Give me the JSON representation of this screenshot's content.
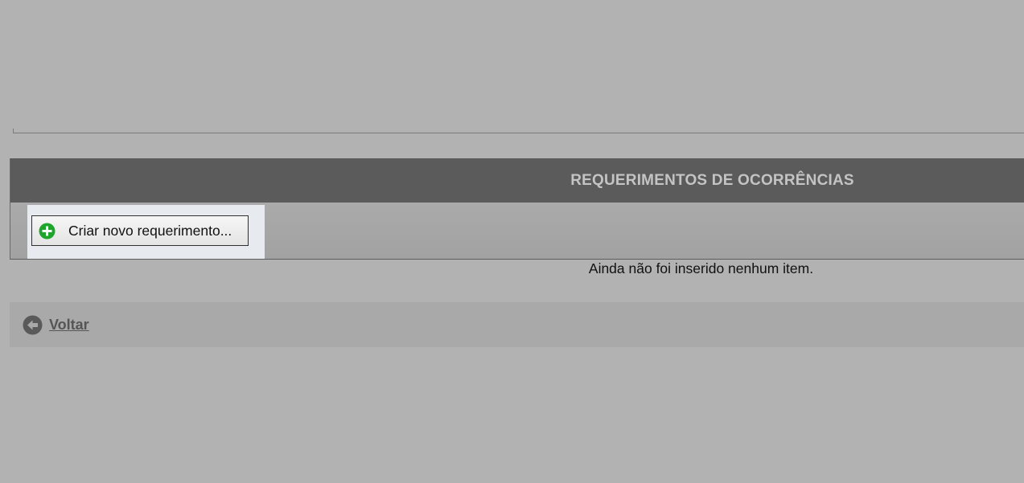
{
  "section": {
    "title": "REQUERIMENTOS DE OCORRÊNCIAS"
  },
  "toolbar": {
    "create_label": "Criar novo requerimento...",
    "create_icon": "plus-circle-icon"
  },
  "list": {
    "empty_message": "Ainda não foi inserido nenhum item."
  },
  "footer": {
    "back_label": "Voltar",
    "back_icon": "arrow-left-circle-icon"
  },
  "colors": {
    "overlay_background": "#b2b2b2",
    "header_background": "#5b5b5b",
    "header_text": "#c4c4c4",
    "highlight": "#e7ebef",
    "add_icon": "#1ea52c",
    "back_icon": "#5a5a5a"
  }
}
